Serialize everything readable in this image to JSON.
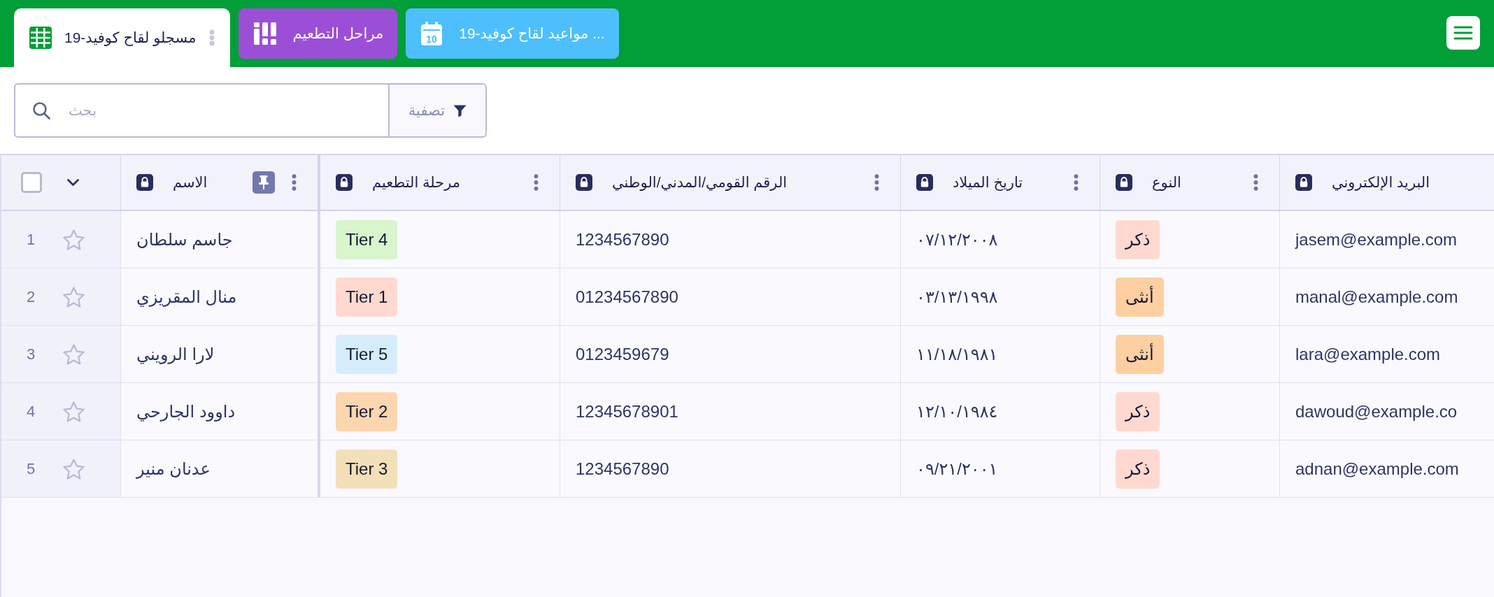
{
  "header": {
    "tabs": [
      {
        "label": "مواعيد لقاح كوفيد-19 ...",
        "kind": "calendar",
        "icon_text": "10",
        "selected": false,
        "color": "#4dbffc"
      },
      {
        "label": "مراحل التطعيم",
        "kind": "board",
        "selected": false,
        "color": "#9b4fd6"
      },
      {
        "label": "مسجلو لقاح كوفيد-19",
        "kind": "grid",
        "selected": true,
        "color": "#029e38"
      }
    ]
  },
  "toolbar": {
    "filter": {
      "label": "تصفية"
    },
    "search": {
      "placeholder": "بحث"
    }
  },
  "table": {
    "columns": [
      {
        "label": "البريد الإلكتروني",
        "locked": true,
        "pinned": false,
        "menu": false
      },
      {
        "label": "النوع",
        "locked": true,
        "pinned": false,
        "menu": true
      },
      {
        "label": "تاريخ الميلاد",
        "locked": true,
        "pinned": false,
        "menu": true
      },
      {
        "label": "الرقم القومي/المدني/الوطني",
        "locked": true,
        "pinned": false,
        "menu": true
      },
      {
        "label": "مرحلة التطعيم",
        "locked": true,
        "pinned": false,
        "menu": true
      },
      {
        "label": "الاسم",
        "locked": true,
        "pinned": true,
        "menu": true
      }
    ],
    "select_all": {
      "checked": false
    },
    "rows": [
      {
        "cells": [
          {
            "kind": "text",
            "text": "jasem@example.com"
          },
          {
            "kind": "tag",
            "text": "ذكر",
            "color": "#ffd9d0"
          },
          {
            "kind": "text",
            "text": "٠٧/١٢/٢٠٠٨"
          },
          {
            "kind": "text",
            "text": "1234567890"
          },
          {
            "kind": "tag",
            "text": "Tier 4",
            "color": "#d9f5cc"
          },
          {
            "kind": "text",
            "text": "جاسم سلطان"
          }
        ],
        "starred": false,
        "number": "1"
      },
      {
        "cells": [
          {
            "kind": "text",
            "text": "manal@example.com"
          },
          {
            "kind": "tag",
            "text": "أنثى",
            "color": "#fdcfa1"
          },
          {
            "kind": "text",
            "text": "٠٣/١٣/١٩٩٨"
          },
          {
            "kind": "text",
            "text": "01234567890"
          },
          {
            "kind": "tag",
            "text": "Tier 1",
            "color": "#ffd9d0"
          },
          {
            "kind": "text",
            "text": "منال المقريزي"
          }
        ],
        "starred": false,
        "number": "2"
      },
      {
        "cells": [
          {
            "kind": "text",
            "text": "lara@example.com"
          },
          {
            "kind": "tag",
            "text": "أنثى",
            "color": "#fdcfa1"
          },
          {
            "kind": "text",
            "text": "١١/١٨/١٩٨١"
          },
          {
            "kind": "text",
            "text": "0123459679"
          },
          {
            "kind": "tag",
            "text": "Tier 5",
            "color": "#d5edfb"
          },
          {
            "kind": "text",
            "text": "لارا الرويني"
          }
        ],
        "starred": false,
        "number": "3"
      },
      {
        "cells": [
          {
            "kind": "text",
            "text": "dawoud@example.co"
          },
          {
            "kind": "tag",
            "text": "ذكر",
            "color": "#ffd9d0"
          },
          {
            "kind": "text",
            "text": "١٢/١٠/١٩٨٤"
          },
          {
            "kind": "text",
            "text": "12345678901"
          },
          {
            "kind": "tag",
            "text": "Tier 2",
            "color": "#fbd6ae"
          },
          {
            "kind": "text",
            "text": "داوود الجارحي"
          }
        ],
        "starred": false,
        "number": "4"
      },
      {
        "cells": [
          {
            "kind": "text",
            "text": "adnan@example.com"
          },
          {
            "kind": "tag",
            "text": "ذكر",
            "color": "#ffd9d0"
          },
          {
            "kind": "text",
            "text": "٠٩/٢١/٢٠٠١"
          },
          {
            "kind": "text",
            "text": "1234567890"
          },
          {
            "kind": "tag",
            "text": "Tier 3",
            "color": "#f3e0b8"
          },
          {
            "kind": "text",
            "text": "عدنان منير"
          }
        ],
        "starred": false,
        "number": "5"
      }
    ]
  }
}
